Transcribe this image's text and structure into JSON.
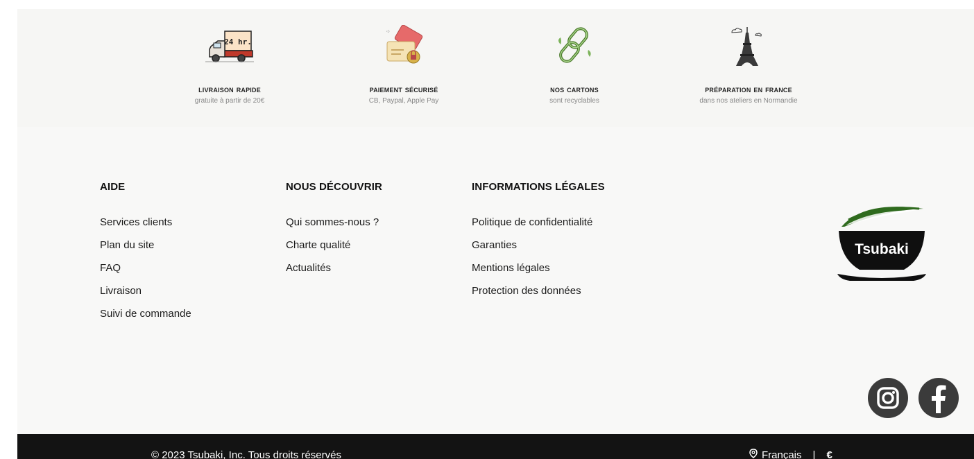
{
  "features": [
    {
      "title": "Livraison rapide",
      "subtitle": "gratuite à partir de 20€",
      "icon": "delivery-truck-24hr-icon"
    },
    {
      "title": "paiement sécurisé",
      "subtitle": "CB, Paypal, Apple Pay",
      "icon": "secure-card-payment-icon"
    },
    {
      "title": "Nos Cartons",
      "subtitle": "sont recyclables",
      "icon": "recycle-chain-icon"
    },
    {
      "title": "préparation en france",
      "subtitle": "dans nos ateliers en Normandie",
      "icon": "eiffel-tower-icon"
    }
  ],
  "footer": {
    "aide": {
      "title": "AIDE",
      "links": [
        "Services clients",
        "Plan du site",
        "FAQ",
        "Livraison",
        "Suivi de commande"
      ]
    },
    "decouvrir": {
      "title": "NOUS DÉCOUVRIR",
      "links": [
        "Qui sommes-nous ?",
        "Charte qualité",
        "Actualités"
      ]
    },
    "legales": {
      "title": "INFORMATIONS LÉGALES",
      "links": [
        "Politique de confidentialité",
        "Garanties",
        "Mentions légales",
        "Protection des données"
      ]
    },
    "logo_text": "Tsubaki"
  },
  "social": [
    {
      "name": "instagram-icon"
    },
    {
      "name": "facebook-icon"
    }
  ],
  "bottom": {
    "copyright": "© 2023 Tsubaki, Inc. Tous droits réservés",
    "language": "Français",
    "separator": "|",
    "currency": "€"
  },
  "colors": {
    "background": "#f8f8f7",
    "bottombar": "#131313",
    "logo_green": "#2f6b1e",
    "social_gray": "#3b3b3b"
  }
}
